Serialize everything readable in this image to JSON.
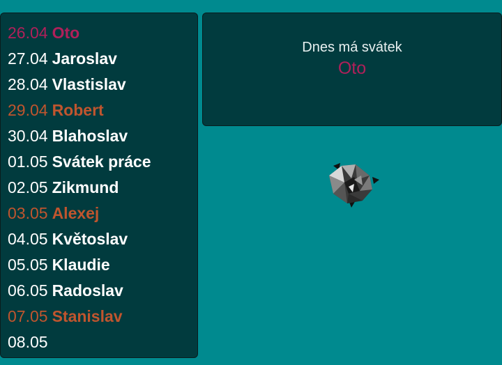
{
  "calendar": {
    "rows": [
      {
        "date": "26.04",
        "name": "Oto",
        "style": "today"
      },
      {
        "date": "27.04",
        "name": "Jaroslav",
        "style": "normal"
      },
      {
        "date": "28.04",
        "name": "Vlastislav",
        "style": "normal"
      },
      {
        "date": "29.04",
        "name": "Robert",
        "style": "weekend"
      },
      {
        "date": "30.04",
        "name": "Blahoslav",
        "style": "normal"
      },
      {
        "date": "01.05",
        "name": "Svátek práce",
        "style": "normal"
      },
      {
        "date": "02.05",
        "name": "Zikmund",
        "style": "normal"
      },
      {
        "date": "03.05",
        "name": "Alexej",
        "style": "weekend"
      },
      {
        "date": "04.05",
        "name": "Květoslav",
        "style": "normal"
      },
      {
        "date": "05.05",
        "name": "Klaudie",
        "style": "normal"
      },
      {
        "date": "06.05",
        "name": "Radoslav",
        "style": "normal"
      },
      {
        "date": "07.05",
        "name": "Stanislav",
        "style": "weekend"
      },
      {
        "date": "08.05",
        "name": "",
        "style": "normal"
      }
    ]
  },
  "info": {
    "label": "Dnes má svátek",
    "name": "Oto"
  },
  "colors": {
    "background": "#008a8f",
    "panel": "#013b3e",
    "today": "#b0205a",
    "weekend": "#c0552e",
    "text": "#ffffff"
  },
  "icons": {
    "decoration": "polyhedron-icon"
  }
}
